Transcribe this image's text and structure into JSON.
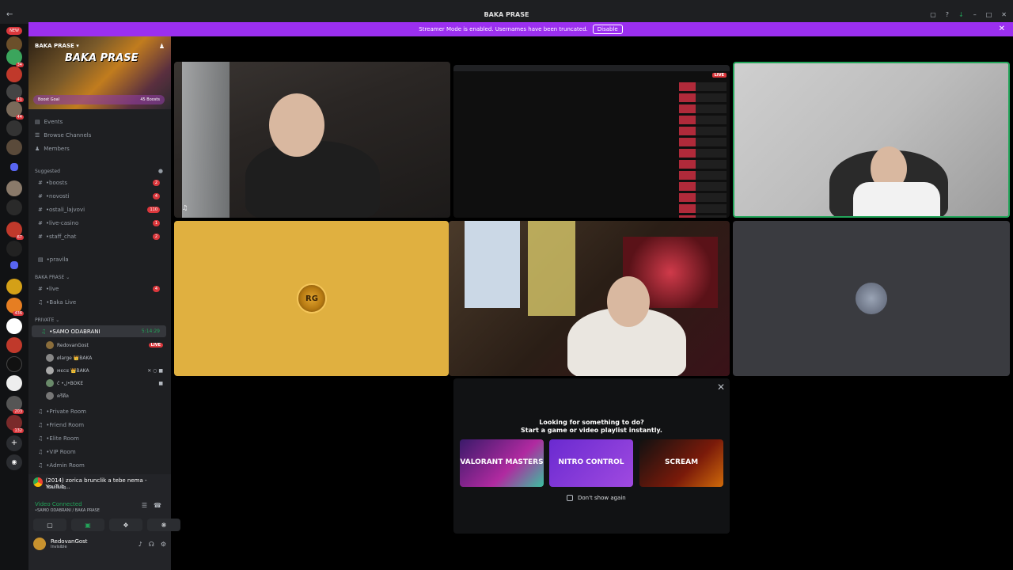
{
  "window": {
    "title": "BAKA PRASE"
  },
  "banner": {
    "text": "Streamer Mode is enabled. Usernames have been truncated.",
    "button": "Disable"
  },
  "server_rail": {
    "new_badge": "NEW",
    "counts": [
      "34",
      "41",
      "44",
      "67",
      "436",
      "203",
      "132"
    ]
  },
  "guild": {
    "name": "BAKA PRASE",
    "banner_logo": "BAKA PRASE",
    "boost_goal": "Boost Goal",
    "boosts": "45 Boosts"
  },
  "nav": [
    "Events",
    "Browse Channels",
    "Members"
  ],
  "suggested": {
    "label": "Suggested",
    "channels": [
      {
        "name": "•boosts",
        "badge": "2"
      },
      {
        "name": "•novosti",
        "badge": "4"
      },
      {
        "name": "•ostali_lajvovi",
        "badge": "110"
      },
      {
        "name": "•live-casino",
        "badge": "1"
      },
      {
        "name": "•staff_chat",
        "badge": "2"
      }
    ]
  },
  "pravila": "•pravila",
  "category_baka": {
    "label": "BAKA PRASE",
    "channels": [
      {
        "name": "•live",
        "badge": "4"
      },
      {
        "name": "•Baka Live",
        "badge": ""
      }
    ]
  },
  "category_private": {
    "label": "PRIVATE",
    "active_channel": {
      "name": "•SAMO ODABRANI",
      "time": "5:14:29"
    },
    "users": [
      {
        "name": "RedovanGost",
        "tag": "LIVE"
      },
      {
        "name": "ølarge 👑BAKA",
        "tag": ""
      },
      {
        "name": "мєсα 👑BAKA",
        "tag": ""
      },
      {
        "name": "ĉ •ل•BOKE",
        "tag": ""
      },
      {
        "name": "ครีดีล",
        "tag": ""
      }
    ],
    "rooms": [
      "•Private Room",
      "•Friend Room",
      "•Elite Room",
      "•VIP Room",
      "•Admin Room"
    ]
  },
  "bottom": {
    "activity_title": "(2014) zorica brunclik a tebe nema - YouTub...",
    "activity_sub": "Watching",
    "video_status": "Video Connected",
    "video_location": "•SAMO ODABRANI / BAKA PRASE",
    "user_name": "RedovanGost",
    "user_status": "Invisible"
  },
  "stage": {
    "live_tag": "LIVE",
    "rg_logo": "RG",
    "activity_panel": {
      "line1": "Looking for something to do?",
      "line2": "Start a game or video playlist instantly.",
      "games": [
        "VALORANT MASTERS",
        "NITRO CONTROL",
        "SCREAM"
      ],
      "checkbox_label": "Don't show again"
    }
  },
  "colors": {
    "banner": "#9b2ff0",
    "live": "#da373c",
    "connected": "#23a55a",
    "rg_tile": "#e0b040",
    "grey_tile": "#3a3b40"
  }
}
